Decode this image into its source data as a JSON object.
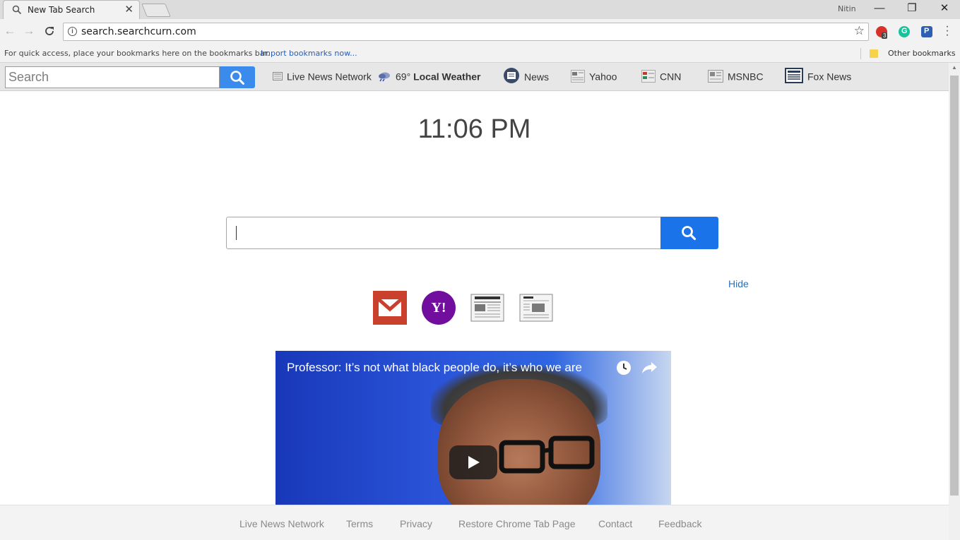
{
  "browser": {
    "tab_title": "New Tab Search",
    "tab_close": "✕",
    "user_name": "Nitin",
    "window_controls": {
      "minimize": "—",
      "restore": "❐",
      "close": "✕"
    },
    "url": "search.searchcurn.com",
    "extension_badge_count": "3"
  },
  "bookmarks_bar": {
    "prompt": "For quick access, place your bookmarks here on the bookmarks bar.",
    "import_link": "Import bookmarks now...",
    "other_bookmarks": "Other bookmarks"
  },
  "extension_bar": {
    "search_placeholder": "Search",
    "links": [
      {
        "label": "Live News Network",
        "icon": "newspaper-icon"
      },
      {
        "label": "69°",
        "bold": "Local Weather",
        "icon": "weather-icon"
      },
      {
        "label": "News",
        "icon": "news-icon"
      },
      {
        "label": "Yahoo",
        "icon": "yahoo-icon"
      },
      {
        "label": "CNN",
        "icon": "cnn-icon"
      },
      {
        "label": "MSNBC",
        "icon": "msnbc-icon"
      },
      {
        "label": "Fox News",
        "icon": "fox-news-icon"
      }
    ]
  },
  "main": {
    "clock": "11:06 PM",
    "hide_label": "Hide",
    "tiles": [
      "gmail-icon",
      "yahoo-mail-icon",
      "daily-news-icon",
      "daily-news-2-icon"
    ],
    "yahoo_tile_text": "Y!",
    "video_title": "Professor: It’s not what black people do, it’s who we are"
  },
  "footer": {
    "links": [
      "Live News Network",
      "Terms",
      "Privacy",
      "Restore Chrome Tab Page",
      "Contact",
      "Feedback"
    ]
  },
  "colors": {
    "search_button": "#3b8bec",
    "main_search_button": "#1a73e8",
    "gmail_red": "#c9412d",
    "yahoo_purple": "#720e9e",
    "link_blue": "#2a6fb5"
  }
}
